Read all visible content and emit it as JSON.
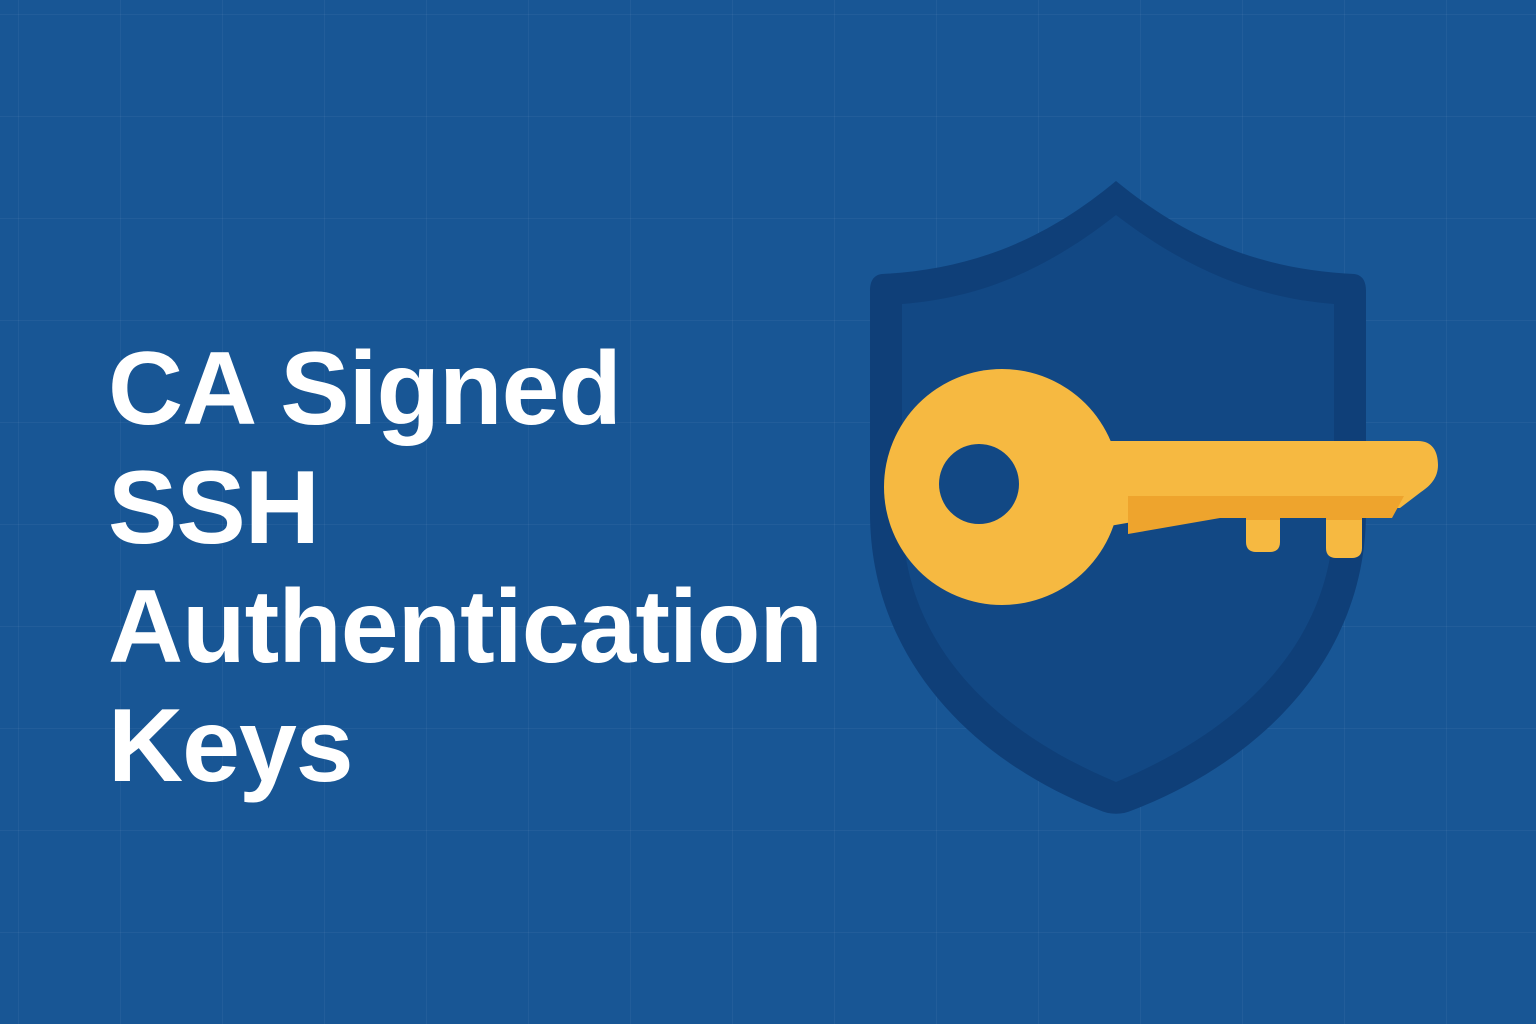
{
  "title": {
    "lines": [
      "CA Signed",
      "SSH",
      "Authentication",
      "Keys"
    ]
  },
  "icons": {
    "emblem": "shield-icon",
    "key": "key-icon"
  },
  "colors": {
    "background": "#185695",
    "text": "#ffffff",
    "shield_outer": "#0f3f78",
    "shield_inner": "#124884",
    "key": "#f6b941",
    "key_shade": "#eea42d"
  }
}
